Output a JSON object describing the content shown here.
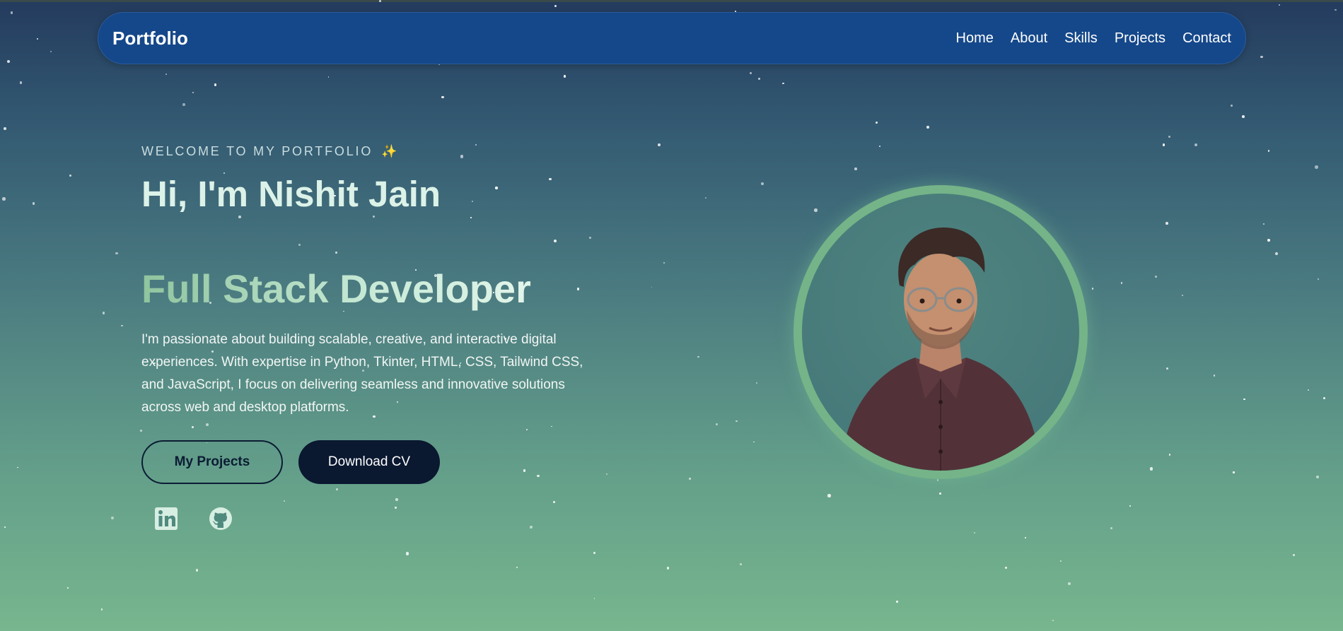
{
  "navbar": {
    "brand": "Portfolio",
    "links": [
      "Home",
      "About",
      "Skills",
      "Projects",
      "Contact"
    ]
  },
  "hero": {
    "eyebrow": "WELCOME TO MY PORTFOLIO",
    "eyebrow_emoji": "✨",
    "headline": "Hi, I'm Nishit Jain",
    "role": "Full Stack Developer",
    "intro": "I'm passionate about building scalable, creative, and interactive digital experiences. With expertise in Python, Tkinter, HTML, CSS, Tailwind CSS, and JavaScript, I focus on delivering seamless and innovative solutions across web and desktop platforms.",
    "primary_button": "My Projects",
    "secondary_button": "Download CV"
  },
  "social": {
    "icons": [
      "linkedin-icon",
      "github-icon"
    ]
  },
  "colors": {
    "navbar": "#15488a",
    "accent_green": "#74b488",
    "dark_button": "#0a1830",
    "headline": "#dcf2e8"
  }
}
